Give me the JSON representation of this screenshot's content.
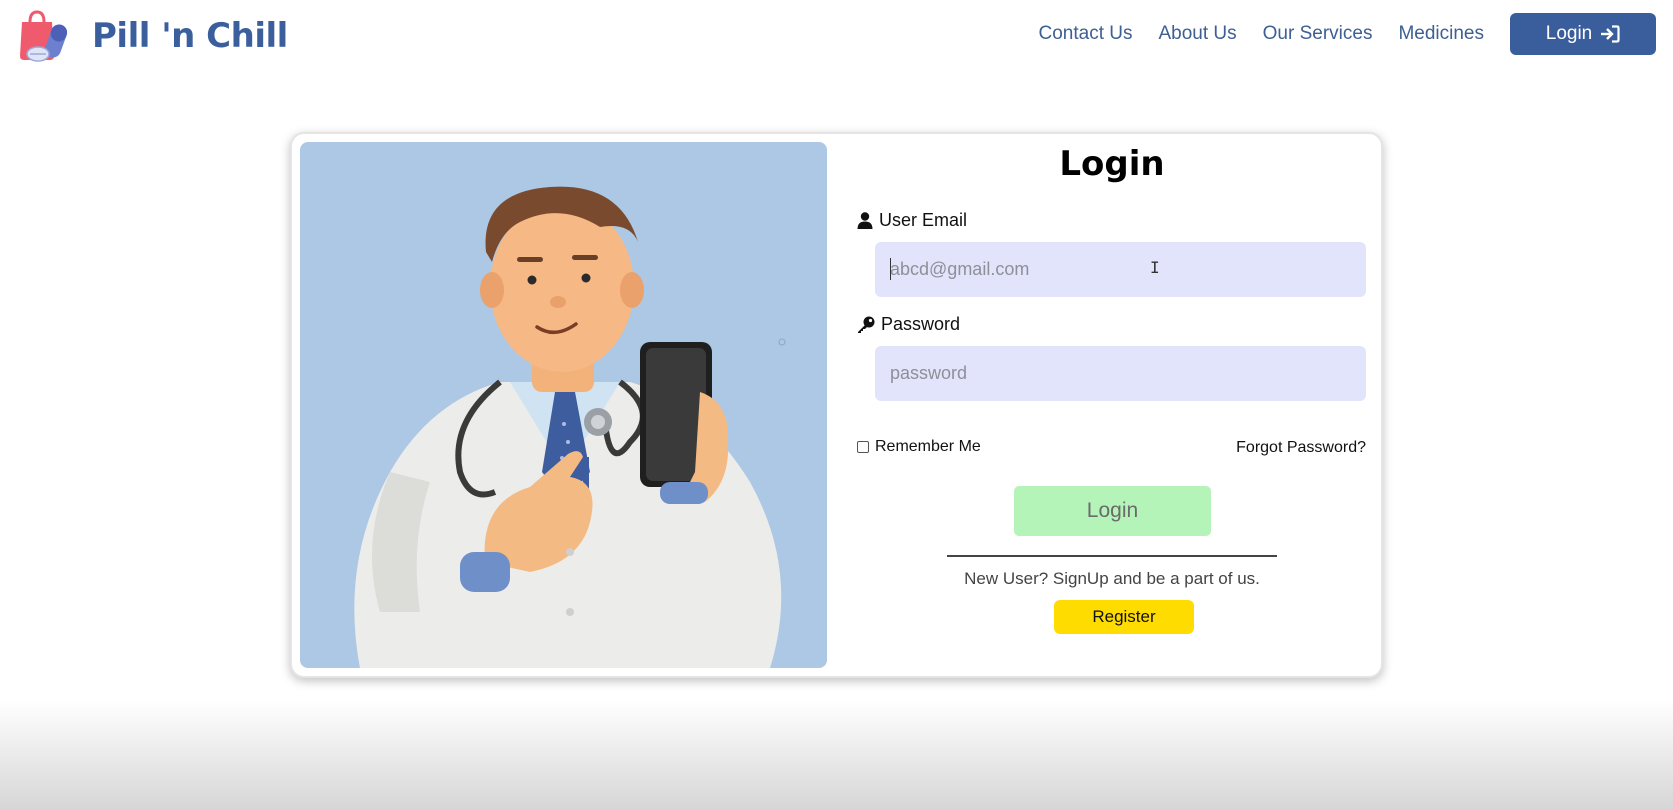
{
  "brand": {
    "name": "Pill 'n Chill"
  },
  "nav": {
    "links": [
      "Contact Us",
      "About Us",
      "Our Services",
      "Medicines"
    ],
    "login_label": "Login",
    "login_icon": "sign-in-icon"
  },
  "form": {
    "title": "Login",
    "email": {
      "label": "User Email",
      "placeholder": "abcd@gmail.com",
      "icon": "user-icon"
    },
    "password": {
      "label": "Password",
      "placeholder": "password",
      "icon": "key-icon"
    },
    "remember_label": "Remember Me",
    "forgot_label": "Forgot Password?",
    "submit_label": "Login",
    "signup_text": "New User? SignUp and be a part of us.",
    "register_label": "Register"
  },
  "colors": {
    "brand_blue": "#3a5e9c",
    "input_bg": "#e2e4fb",
    "login_button": "#b5f4b9",
    "register_button": "#ffdc00",
    "illustration_bg": "#adc8e4"
  }
}
